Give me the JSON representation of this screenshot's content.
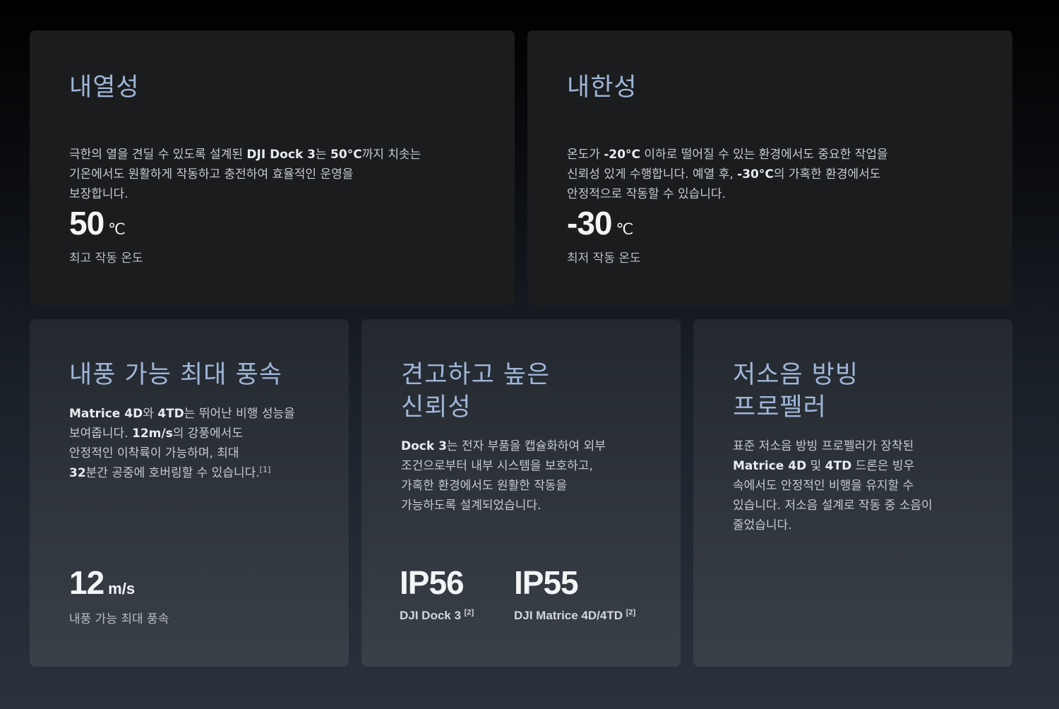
{
  "cards": {
    "heat": {
      "title": "내열성",
      "desc_a": "극한의 열을 견딜 수 있도록 설계된 ",
      "desc_b": "DJI Dock 3",
      "desc_c": "는 ",
      "desc_d": "50°C",
      "desc_e": "까지 치솟는",
      "desc_f": "기온에서도 원활하게 작동하고 충전하여 효율적인 운영을",
      "desc_g": "보장합니다.",
      "value": "50",
      "unit": "℃",
      "label": "최고 작동 온도"
    },
    "cold": {
      "title": "내한성",
      "desc_a": "온도가 ",
      "desc_b": "-20°C",
      "desc_c": " 이하로 떨어질 수 있는 환경에서도 중요한 작업을",
      "desc_d": "신뢰성 있게 수행합니다. 예열 후, ",
      "desc_e": "-30°C",
      "desc_f": "의 가혹한 환경에서도",
      "desc_g": "안정적으로 작동할 수 있습니다.",
      "value": "-30",
      "unit": "℃",
      "label": "최저 작동 온도"
    },
    "wind": {
      "title": "내풍 가능 최대 풍속",
      "desc_a": "Matrice 4D",
      "desc_b": "와 ",
      "desc_c": "4TD",
      "desc_d": "는 뛰어난 비행 성능을",
      "desc_e": "보여줍니다. ",
      "desc_f": "12m/s",
      "desc_g": "의 강풍에서도",
      "desc_h": "안정적인 이착륙이 가능하며, 최대",
      "desc_i": "32",
      "desc_j": "분간 공중에 호버링할 수 있습니다.",
      "desc_sup": "[1]",
      "value": "12",
      "unit": "m/s",
      "label": "내풍 가능 최대 풍속"
    },
    "ip": {
      "title_line1": "견고하고 높은",
      "title_line2": "신뢰성",
      "desc_a": "Dock 3",
      "desc_b": "는 전자 부품을 캡슐화하여 외부",
      "desc_c": "조건으로부터 내부 시스템을 보호하고,",
      "desc_d": "가혹한 환경에서도 원활한 작동을",
      "desc_e": "가능하도록 설계되었습니다.",
      "value1": "IP56",
      "label1": "DJI Dock 3",
      "sup1": "[2]",
      "value2": "IP55",
      "label2": "DJI Matrice 4D/4TD",
      "sup2": "[2]"
    },
    "prop": {
      "title_line1": "저소음 방빙",
      "title_line2": "프로펠러",
      "desc_a": "표준 저소음 방빙 프로펠러가 장착된",
      "desc_b": "Matrice 4D",
      "desc_c": " 및 ",
      "desc_d": "4TD",
      "desc_e": " 드론은 빙우",
      "desc_f": "속에서도 안정적인 비행을 유지할 수",
      "desc_g": "있습니다. 저소음 설계로 작동 중 소음이",
      "desc_h": "줄었습니다."
    }
  }
}
